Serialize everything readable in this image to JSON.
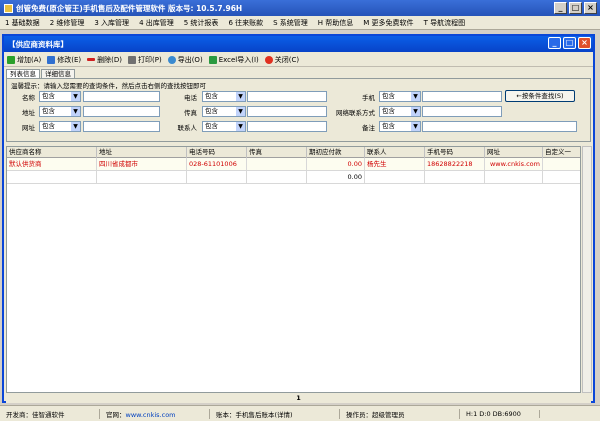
{
  "app_title": "创管免费(原企管王)手机售后及配件管理软件 版本号: 10.5.7.96H",
  "menu": [
    "1 基础数据",
    "2 维修管理",
    "3 入库管理",
    "4 出库管理",
    "5 统计报表",
    "6 往来账款",
    "S 系统管理",
    "H 帮助信息",
    "M 更多免费软件",
    "T 导航流程图"
  ],
  "window": {
    "title": "【供应商资料库】"
  },
  "toolbar": {
    "add": "增加(A)",
    "edit": "修改(E)",
    "delete": "删除(D)",
    "print": "打印(P)",
    "export": "导出(O)",
    "import": "Excel导入(I)",
    "close": "关闭(C)"
  },
  "tabs": [
    "列表信息",
    "详细信息"
  ],
  "search": {
    "hint": "温馨提示：请输入您需要的查询条件，然后点击右侧的查找按钮即可",
    "labels": [
      "名称",
      "电话",
      "手机",
      "地址",
      "传真",
      "网络联系方式",
      "网址",
      "联系人",
      "备注"
    ],
    "op": "包含",
    "button": "←按条件查找(S)"
  },
  "grid": {
    "columns": [
      "供应商名称",
      "地址",
      "电话号码",
      "传真",
      "期初应付款",
      "联系人",
      "手机号码",
      "网址",
      "自定义一"
    ],
    "rows": [
      [
        "默认供货商",
        "四川省成都市",
        "028-61101006",
        "",
        "0.00",
        "杨先生",
        "18628822218",
        "www.cnkis.com",
        ""
      ],
      [
        "",
        "",
        "",
        "",
        "0.00",
        "",
        "",
        "",
        ""
      ]
    ]
  },
  "pager": "1",
  "status": {
    "dev": "开发商：佳智通软件",
    "site_label": "官网：",
    "site": "www.cnkis.com",
    "account": "账本：手机售后账本(详情)",
    "operator": "操作员：超级管理员",
    "coords": "H:1 D:0 DB:6900"
  }
}
